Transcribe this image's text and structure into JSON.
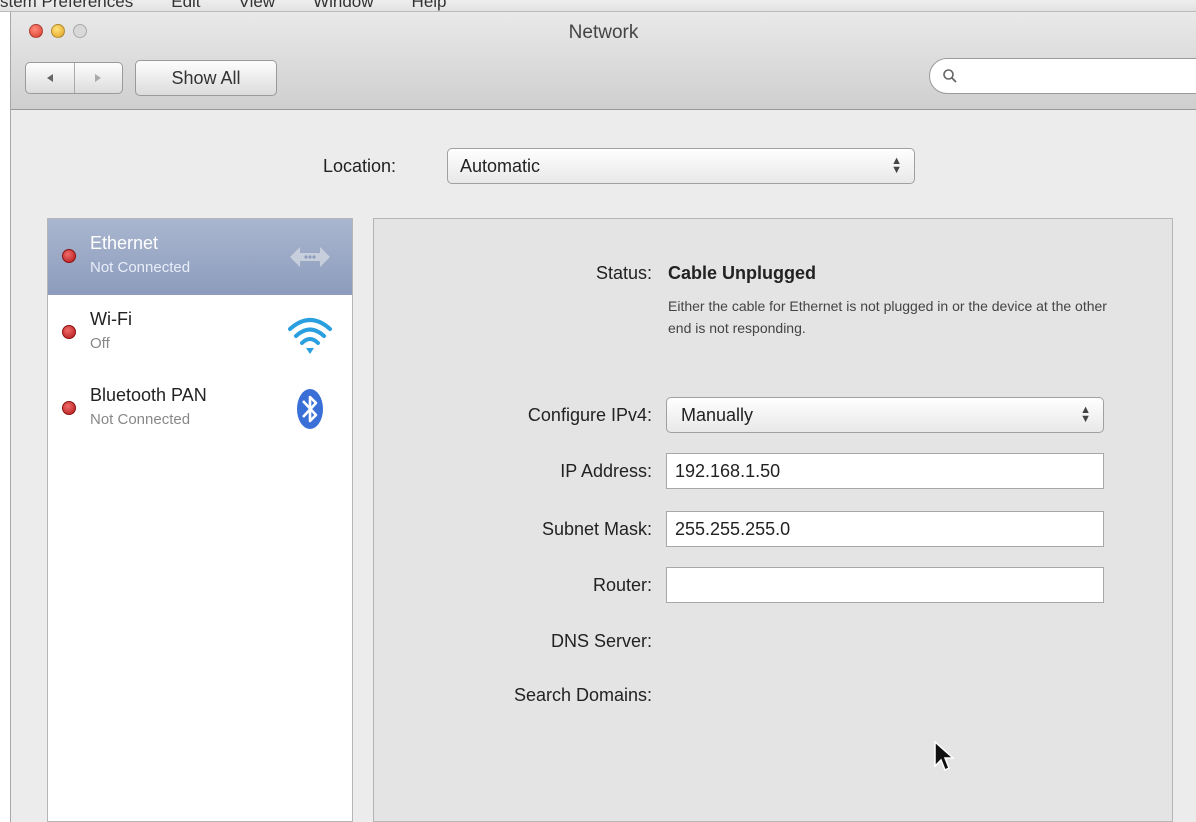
{
  "menubar": {
    "items": [
      "stem Preferences",
      "Edit",
      "View",
      "Window",
      "Help"
    ]
  },
  "window": {
    "title": "Network",
    "back_icon": "back-arrow-icon",
    "forward_icon": "forward-arrow-icon",
    "show_all_label": "Show All",
    "search_placeholder": ""
  },
  "location": {
    "label": "Location:",
    "value": "Automatic"
  },
  "services": [
    {
      "name": "Ethernet",
      "status": "Not Connected",
      "icon": "ethernet-icon",
      "selected": true,
      "status_color": "#cc2222"
    },
    {
      "name": "Wi-Fi",
      "status": "Off",
      "icon": "wifi-icon",
      "selected": false,
      "status_color": "#cc2222"
    },
    {
      "name": "Bluetooth PAN",
      "status": "Not Connected",
      "icon": "bluetooth-icon",
      "selected": false,
      "status_color": "#cc2222"
    }
  ],
  "detail": {
    "status_label": "Status:",
    "status_value": "Cable Unplugged",
    "status_description": "Either the cable for Ethernet is not plugged in or the device at the other end is not responding.",
    "configure_label": "Configure IPv4:",
    "configure_value": "Manually",
    "ip_label": "IP Address:",
    "ip_value": "192.168.1.50",
    "subnet_label": "Subnet Mask:",
    "subnet_value": "255.255.255.0",
    "router_label": "Router:",
    "router_value": "",
    "dns_label": "DNS Server:",
    "search_domains_label": "Search Domains:"
  },
  "colors": {
    "selection": "#8d9cbd",
    "status_red": "#cc2222"
  }
}
